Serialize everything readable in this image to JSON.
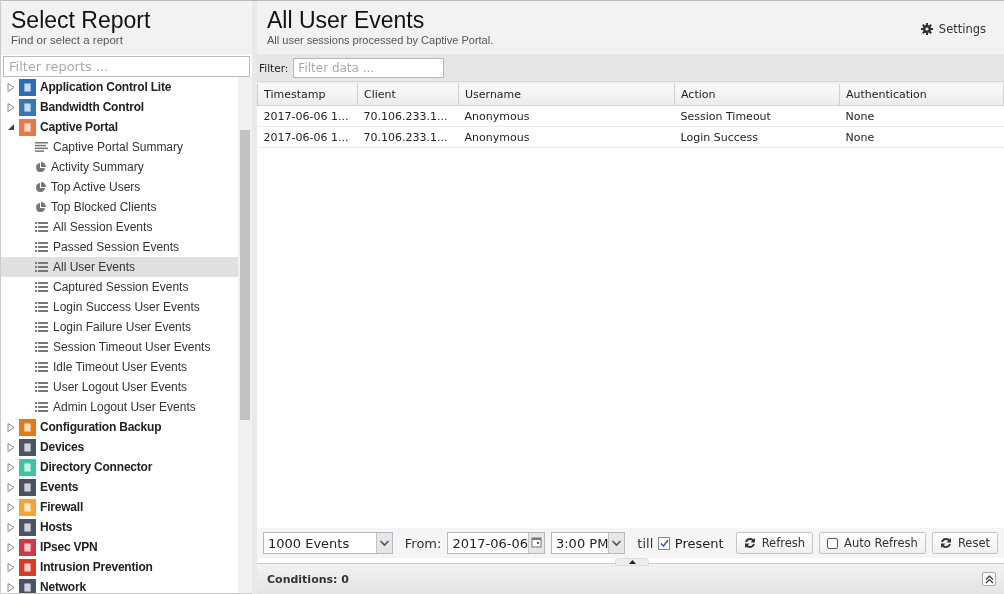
{
  "sidebar": {
    "title": "Select Report",
    "subtitle": "Find or select a report",
    "filter": {
      "placeholder": "Filter reports ..."
    },
    "tree": [
      {
        "label": "Application Control Lite",
        "expanded": false,
        "color": "#2d6db5"
      },
      {
        "label": "Bandwidth Control",
        "expanded": false,
        "color": "#3a76b0"
      },
      {
        "label": "Captive Portal",
        "expanded": true,
        "color": "#ea7a45",
        "children": [
          {
            "label": "Captive Portal Summary",
            "kind": "text",
            "selected": false
          },
          {
            "label": "Activity Summary",
            "kind": "pie",
            "selected": false
          },
          {
            "label": "Top Active Users",
            "kind": "pie",
            "selected": false
          },
          {
            "label": "Top Blocked Clients",
            "kind": "pie",
            "selected": false
          },
          {
            "label": "All Session Events",
            "kind": "list",
            "selected": false
          },
          {
            "label": "Passed Session Events",
            "kind": "list",
            "selected": false
          },
          {
            "label": "All User Events",
            "kind": "list",
            "selected": true
          },
          {
            "label": "Captured Session Events",
            "kind": "list",
            "selected": false
          },
          {
            "label": "Login Success User Events",
            "kind": "list",
            "selected": false
          },
          {
            "label": "Login Failure User Events",
            "kind": "list",
            "selected": false
          },
          {
            "label": "Session Timeout User Events",
            "kind": "list",
            "selected": false
          },
          {
            "label": "Idle Timeout User Events",
            "kind": "list",
            "selected": false
          },
          {
            "label": "User Logout User Events",
            "kind": "list",
            "selected": false
          },
          {
            "label": "Admin Logout User Events",
            "kind": "list",
            "selected": false
          }
        ]
      },
      {
        "label": "Configuration Backup",
        "expanded": false,
        "color": "#e07a1f"
      },
      {
        "label": "Devices",
        "expanded": false,
        "color": "#4b5566"
      },
      {
        "label": "Directory Connector",
        "expanded": false,
        "color": "#3cc4a4"
      },
      {
        "label": "Events",
        "expanded": false,
        "color": "#4a5262"
      },
      {
        "label": "Firewall",
        "expanded": false,
        "color": "#f2a43a"
      },
      {
        "label": "Hosts",
        "expanded": false,
        "color": "#4d5565"
      },
      {
        "label": "IPsec VPN",
        "expanded": false,
        "color": "#d23545"
      },
      {
        "label": "Intrusion Prevention",
        "expanded": false,
        "color": "#d83c28"
      },
      {
        "label": "Network",
        "expanded": false,
        "color": "#4a5363"
      }
    ]
  },
  "report": {
    "title": "All User Events",
    "subtitle": "All user sessions processed by Captive Portal.",
    "settings": "Settings",
    "filter": {
      "label": "Filter:",
      "placeholder": "Filter data ..."
    },
    "table": {
      "columns": [
        "Timestamp",
        "Client",
        "Username",
        "Action",
        "Authentication"
      ],
      "rows": [
        [
          "2017-06-06 1...",
          "70.106.233.1...",
          "Anonymous",
          "Session Timeout",
          "None"
        ],
        [
          "2017-06-06 1...",
          "70.106.233.1...",
          "Anonymous",
          "Login Success",
          "None"
        ]
      ]
    },
    "toolbar": {
      "limit": "1000 Events",
      "from_label": "From:",
      "date": "2017-06-06",
      "time": "3:00 PM",
      "till_label": "till",
      "present": {
        "label": "Present",
        "checked": true
      },
      "refresh": "Refresh",
      "auto_refresh": {
        "label": "Auto Refresh",
        "checked": false
      },
      "reset": "Reset"
    },
    "conditions": "Conditions: 0"
  }
}
